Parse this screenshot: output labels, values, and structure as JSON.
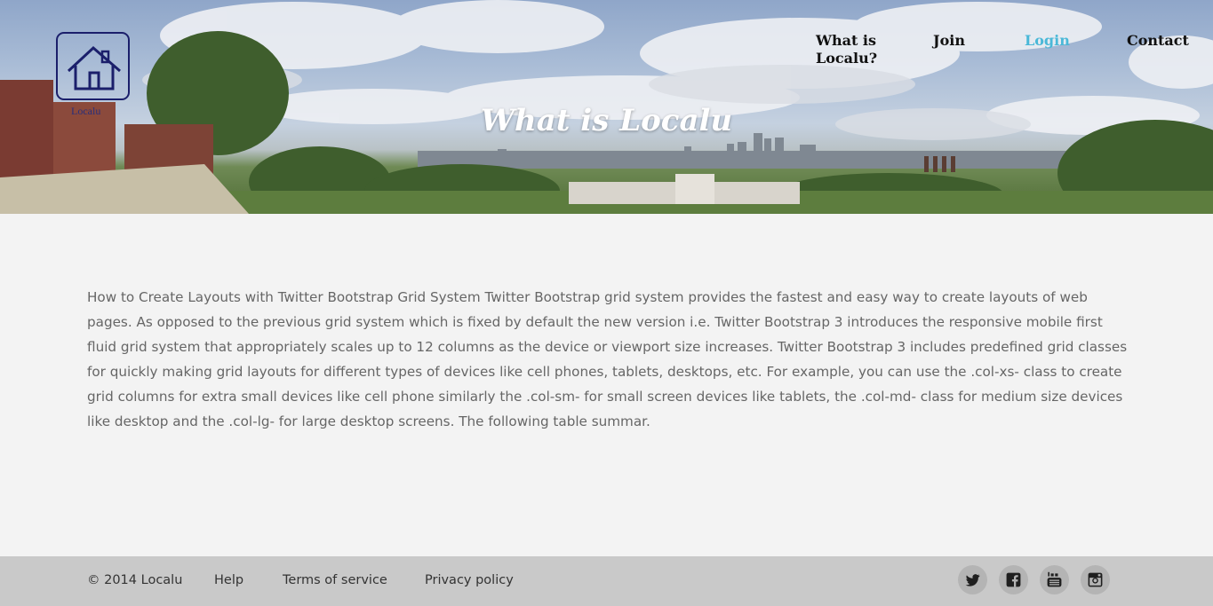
{
  "brand": {
    "logo_text": "Localu"
  },
  "nav": {
    "items": [
      {
        "label": "What is Localu?"
      },
      {
        "label": "Join"
      },
      {
        "label": "Login",
        "active": true
      },
      {
        "label": "Contact"
      }
    ],
    "active_color": "#4ab8d8"
  },
  "hero": {
    "title": "What is Localu"
  },
  "main": {
    "body": "How to Create Layouts with Twitter Bootstrap Grid System Twitter Bootstrap grid system provides the fastest and easy way to create layouts of web pages. As opposed to the previous grid system which is fixed by default the new version i.e. Twitter Bootstrap 3 introduces the responsive mobile first fluid grid system that appropriately scales up to 12 columns as the device or viewport size increases. Twitter Bootstrap 3 includes predefined grid classes for quickly making grid layouts for different types of devices like cell phones, tablets, desktops, etc. For example, you can use the .col-xs- class to create grid columns for extra small devices like cell phone similarly the .col-sm- for small screen devices like tablets, the .col-md- class for medium size devices like desktop and the .col-lg- for large desktop screens. The following table summar."
  },
  "footer": {
    "copyright": "© 2014 Localu",
    "links": [
      "Help",
      "Terms of service",
      "Privacy policy"
    ],
    "social": [
      "twitter-icon",
      "facebook-icon",
      "youtube-icon",
      "instagram-icon"
    ]
  }
}
